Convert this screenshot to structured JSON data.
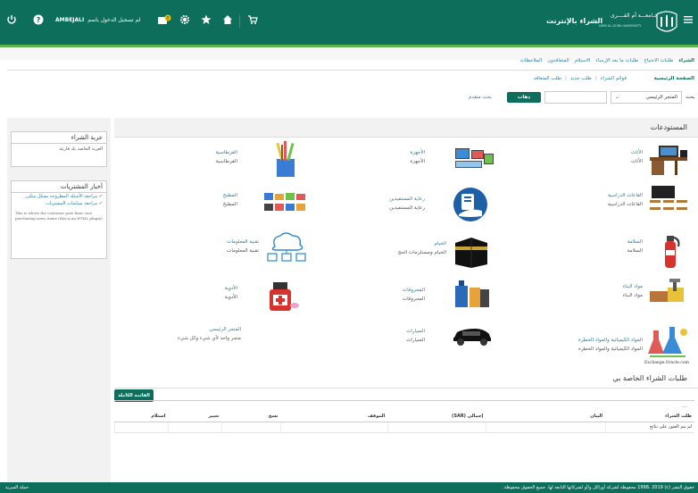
{
  "header": {
    "user_name": "AMBEJALI",
    "user_text": "لم تسجيل الدخول باسم",
    "brand_title": "الشراء بالإنترنت",
    "university_name": "جـامعـــة أم القــــرى",
    "university_sub": "UMM AL-QURA UNIVERSITY"
  },
  "nav": {
    "tabs": [
      "الشراء",
      "طلبات الاحتياج",
      "طلبات ما بعد الإرساء",
      "الاستلام",
      "المتعاقدون",
      "الملاحظات"
    ]
  },
  "subnav": {
    "home": "الصفحة الرئيسية",
    "links": [
      "قوائم الشراء",
      "طلب جديد",
      "طلب المتعاقد"
    ]
  },
  "search": {
    "label": "بحث",
    "selected": "المتجر الرئيسي",
    "go": "ذهاب",
    "advanced": "بحث متقدم"
  },
  "cart": {
    "title": "عربة الشراء",
    "text": "العربة الخاصة بك فارغة"
  },
  "news": {
    "title": "أخبار المشتريات",
    "items": [
      "مراجعة الأسئلة المطروحة بشكل متكرر",
      "مراجعة سياسات المشتريات"
    ],
    "note": "This is where the customer puts their own purchasing news items (this is an HTML plugin)"
  },
  "stores": {
    "title": "المستودعات",
    "items": [
      {
        "title": "الأثاث",
        "subtitle": "الأثاث",
        "icon": "furniture-desk-icon"
      },
      {
        "title": "الأجهزة",
        "subtitle": "الأجهزة",
        "icon": "computer-devices-icon"
      },
      {
        "title": "القرطاسية",
        "subtitle": "القرطاسية",
        "icon": "stationery-pencils-icon"
      },
      {
        "title": "القاعات الدراسية",
        "subtitle": "القاعات الدراسية",
        "icon": "classroom-icon"
      },
      {
        "title": "رعاية المستفيدين",
        "subtitle": "رعاية المستفيدين",
        "icon": "beneficiary-care-icon"
      },
      {
        "title": "المطبخ",
        "subtitle": "المطبخ",
        "icon": "kitchen-appliances-icon"
      },
      {
        "title": "السلامة",
        "subtitle": "السلامة",
        "icon": "fire-extinguisher-icon"
      },
      {
        "title": "الخيام",
        "subtitle": "الخيام ومستلزمات الحج",
        "icon": "kaaba-tent-icon"
      },
      {
        "title": "تقنية المعلومات",
        "subtitle": "تقنية المعلومات",
        "icon": "cloud-network-icon"
      },
      {
        "title": "مواد البناء",
        "subtitle": "مواد البناء",
        "icon": "building-materials-icon"
      },
      {
        "title": "المحروقات",
        "subtitle": "المحروقات",
        "icon": "fuel-cans-icon"
      },
      {
        "title": "الأدوية",
        "subtitle": "الأدوية",
        "icon": "medicine-bottle-icon"
      },
      {
        "title": "المواد الكيميائية والمواد الخطرة",
        "subtitle": "المواد الكيميائية والمواد الخطرة",
        "icon": "chemistry-flasks-icon"
      },
      {
        "title": "السيارات",
        "subtitle": "السيارات",
        "icon": "car-icon"
      },
      {
        "title": "المتجر الرئيسي",
        "subtitle": "متجر واحد لأي شيء وكل شيء",
        "icon": ""
      }
    ],
    "attribution": "Exchange.Oracle.com"
  },
  "requests": {
    "title": "طلبات الشراء الخاصة بي",
    "full_list": "القائمة الكاملة",
    "ellipsis": "...",
    "columns": [
      "طلب الشراء",
      "البيان",
      "إجمالي (SAR)",
      "الموقف",
      "نسخ",
      "تغيير",
      "استلام"
    ],
    "empty": "لم يتم العثور على نتائج"
  },
  "footer": {
    "copyright": "حقوق النشر (c) 1998، 2019 محفوظة لشركة أوراكل و/أو لشركاتها التابعة لها. جميع الحقوق محفوظة.",
    "link": "حملة السرية"
  },
  "colors": {
    "brand": "#0d6e5b",
    "accent": "#5fb34a",
    "link": "#2a7e9e"
  }
}
